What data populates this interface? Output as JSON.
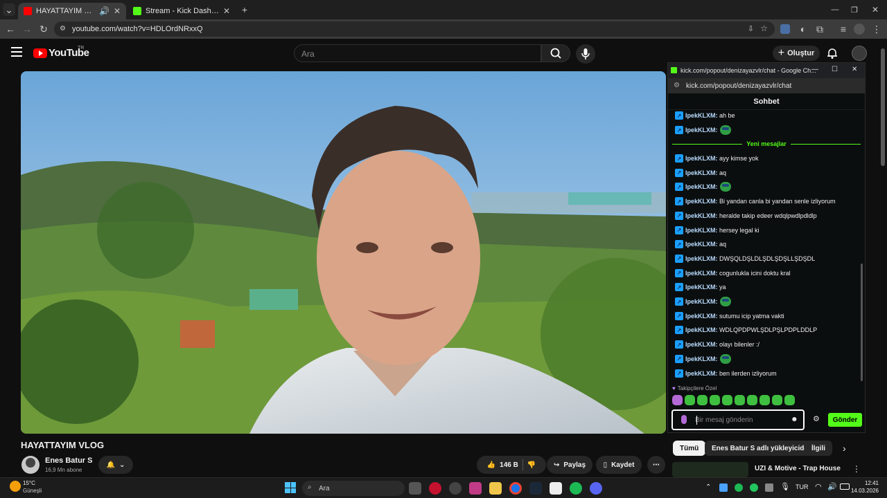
{
  "browser": {
    "tabs": [
      {
        "title": "HAYATTAYIM VLOG - YouTube",
        "active": true
      },
      {
        "title": "Stream - Kick Dashboard",
        "active": false
      }
    ],
    "url": "youtube.com/watch?v=HDLOrdNRxxQ"
  },
  "youtube": {
    "logo_text": "YouTube",
    "logo_region": "TR",
    "search_placeholder": "Ara",
    "create_label": "Oluştur",
    "video_title": "HAYATTAYIM VLOG",
    "channel_name": "Enes Batur S",
    "subscribers": "16,9 Mn abone",
    "like_count": "146 B",
    "share_label": "Paylaş",
    "save_label": "Kaydet",
    "chips": [
      "Tümü",
      "Enes Batur S adlı yükleyiciden",
      "İlgili"
    ],
    "suggested_title": "UZI & Motive - Trap House"
  },
  "chat_popup": {
    "window_title": "kick.com/popout/denizayazvlr/chat - Google Ch...",
    "url": "kick.com/popout/denizayazvlr/chat",
    "header": "Sohbet",
    "new_messages_label": "Yeni mesajlar",
    "followers_only_label": "Takipçilere Özel",
    "input_placeholder": "Bir mesaj gönderin",
    "send_label": "Gönder",
    "messages_before": [
      {
        "user": "IpekKLXM:",
        "text": "ah be",
        "emote": false
      },
      {
        "user": "IpekKLXM:",
        "text": "",
        "emote": true
      }
    ],
    "messages_after": [
      {
        "user": "IpekKLXM:",
        "text": "ayy kimse yok",
        "emote": false
      },
      {
        "user": "IpekKLXM:",
        "text": "aq",
        "emote": false
      },
      {
        "user": "IpekKLXM:",
        "text": "",
        "emote": true
      },
      {
        "user": "IpekKLXM:",
        "text": "Bi yandan canla bi yandan senle izliyorum",
        "emote": false
      },
      {
        "user": "IpekKLXM:",
        "text": "heralde takip edeer wdqlpwdlpdldlp",
        "emote": false
      },
      {
        "user": "IpekKLXM:",
        "text": "hersey legal ki",
        "emote": false
      },
      {
        "user": "IpekKLXM:",
        "text": "aq",
        "emote": false
      },
      {
        "user": "IpekKLXM:",
        "text": "DWŞQLDŞLDLŞDLŞDŞLLŞDŞDL",
        "emote": false
      },
      {
        "user": "IpekKLXM:",
        "text": "cogunlukla icini doktu kral",
        "emote": false
      },
      {
        "user": "IpekKLXM:",
        "text": "ya",
        "emote": false
      },
      {
        "user": "IpekKLXM:",
        "text": "",
        "emote": true
      },
      {
        "user": "IpekKLXM:",
        "text": "sutumu icip yatma vakti",
        "emote": false
      },
      {
        "user": "IpekKLXM:",
        "text": "WDLQPDPWLŞDLPŞLPDPLDDLP",
        "emote": false
      },
      {
        "user": "IpekKLXM:",
        "text": "olayı bilenler :/",
        "emote": false
      },
      {
        "user": "IpekKLXM:",
        "text": "",
        "emote": true
      },
      {
        "user": "IpekKLXM:",
        "text": "ben ilerden izliyorum",
        "emote": false
      }
    ]
  },
  "taskbar": {
    "weather_temp": "15°C",
    "weather_desc": "Güneşli",
    "search_label": "Ara",
    "language": "TUR",
    "time": "12:41",
    "date": "14.03.2026"
  },
  "colors": {
    "kick_green": "#53fc18",
    "yt_red": "#ff0000",
    "chat_user": "#b9dcff"
  }
}
